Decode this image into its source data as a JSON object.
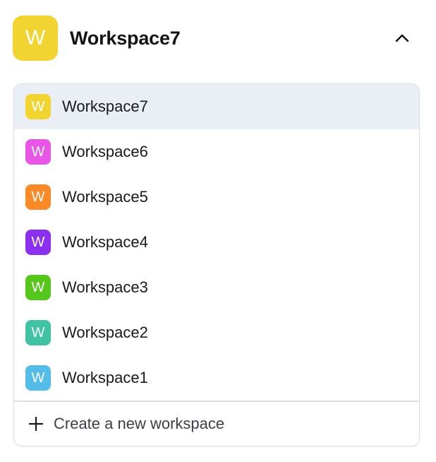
{
  "header": {
    "avatar_letter": "W",
    "avatar_color": "#f2d431",
    "title": "Workspace7",
    "toggle_icon": "chevron-up-icon"
  },
  "dropdown": {
    "items": [
      {
        "letter": "W",
        "label": "Workspace7",
        "color": "#f2d431",
        "selected": true
      },
      {
        "letter": "W",
        "label": "Workspace6",
        "color": "#e955e6",
        "selected": false
      },
      {
        "letter": "W",
        "label": "Workspace5",
        "color": "#f98a27",
        "selected": false
      },
      {
        "letter": "W",
        "label": "Workspace4",
        "color": "#8b2ff0",
        "selected": false
      },
      {
        "letter": "W",
        "label": "Workspace3",
        "color": "#55c71a",
        "selected": false
      },
      {
        "letter": "W",
        "label": "Workspace2",
        "color": "#3fc3a3",
        "selected": false
      },
      {
        "letter": "W",
        "label": "Workspace1",
        "color": "#53bce9",
        "selected": false
      }
    ],
    "create_icon": "plus-icon",
    "create_label": "Create a new workspace",
    "selected_bg": "#eaeef5"
  }
}
